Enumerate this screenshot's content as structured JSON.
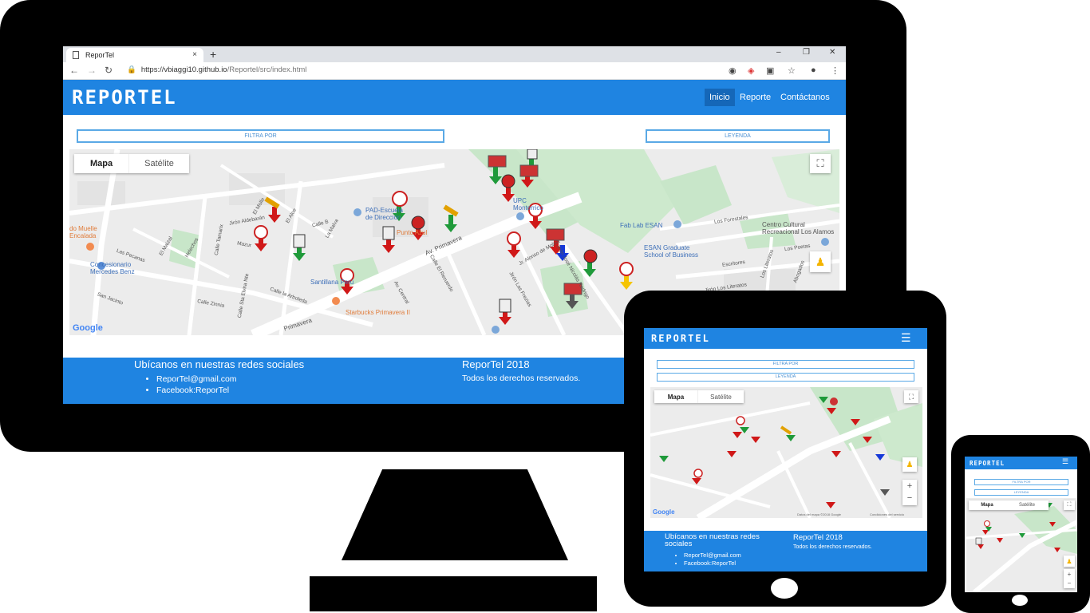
{
  "browser": {
    "tab_title": "ReporTel",
    "close_tab": "×",
    "new_tab": "+",
    "url_host": "https://vbiaggi10.github.io",
    "url_path": "/Reportel/src/index.html",
    "minimize": "–",
    "maximize": "❐",
    "close": "✕"
  },
  "app": {
    "logo": "REPORTEL",
    "nav": [
      "Inicio",
      "Reporte",
      "Contáctanos"
    ],
    "filter_label": "FILTRA POR",
    "legend_label": "LEYENDA",
    "menu_icon": "☰"
  },
  "map": {
    "tab_map": "Mapa",
    "tab_satellite": "Satélite",
    "google": "Google",
    "zoom_in": "+",
    "zoom_out": "−",
    "attribution": "Datos del mapa ©2018 Google",
    "terms": "Condiciones del servicio",
    "labels": {
      "muelle": "do Muelle\nEncalada",
      "concesionario": "Concesionario\nMercedes Benz",
      "pad": "PAD-Escuela\nde Dirección",
      "upc": "UPC\nMonterrico",
      "fablab": "Fab Lab ESAN",
      "esan": "ESAN Graduate\nSchool of Business",
      "centro": "Centro Cultural\nRecreacional Los Alamos",
      "santillana": "Santillana Perú",
      "starbucks": "Starbucks Primavera II",
      "azul": "Punto Azul",
      "av_primavera": "Av. Primavera",
      "primavera": "Primavera",
      "forestales": "Los Forestales",
      "poetas": "Los Poetas",
      "escritores": "Escritores",
      "literatos": "Jirón Los Literatos",
      "pecanas": "Las Pecanas",
      "san_jacinto": "San Jacinto",
      "zinnia": "Calle Zinnia",
      "arboleda": "Calle la Arboleda",
      "aldebaran": "Jirón Aldebarán",
      "mazur": "Mazur",
      "alonso": "Jr. Alonso de Molina",
      "jose_nicolas": "Jirón José Nicolás Rodrigo",
      "recuerdo": "Calle El Recuerdo",
      "frezias": "Jirón Las Frezias",
      "central": "Av. Central",
      "literatos_v": "Los Literatos",
      "abogados": "Abogados",
      "tamarix": "Calle Tamarix",
      "almendros": "Almendros",
      "calle_b": "Calle B",
      "calle_5": "Calle 5",
      "la_malva": "La Malva",
      "el_aloe": "El Aloe",
      "el_molle": "El Molle",
      "el_maizal": "El Maizal",
      "helechos": "Helechos",
      "sta_elvira": "Calle Sta Elvira Nte"
    }
  },
  "footer": {
    "social_title": "Ubícanos en nuestras redes sociales",
    "social_items": [
      "ReporTel@gmail.com",
      "Facebook:ReporTel"
    ],
    "copy_title": "ReporTel 2018",
    "copy_text": "Todos los derechos reservados."
  },
  "colors": {
    "brand": "#1f84e1",
    "arrow_red": "#d01818",
    "arrow_green": "#1f9a3a",
    "arrow_blue": "#1638d8",
    "arrow_yellow": "#f5c400",
    "arrow_gray": "#555555",
    "park": "#c5e8c5",
    "road": "#ffffff"
  }
}
